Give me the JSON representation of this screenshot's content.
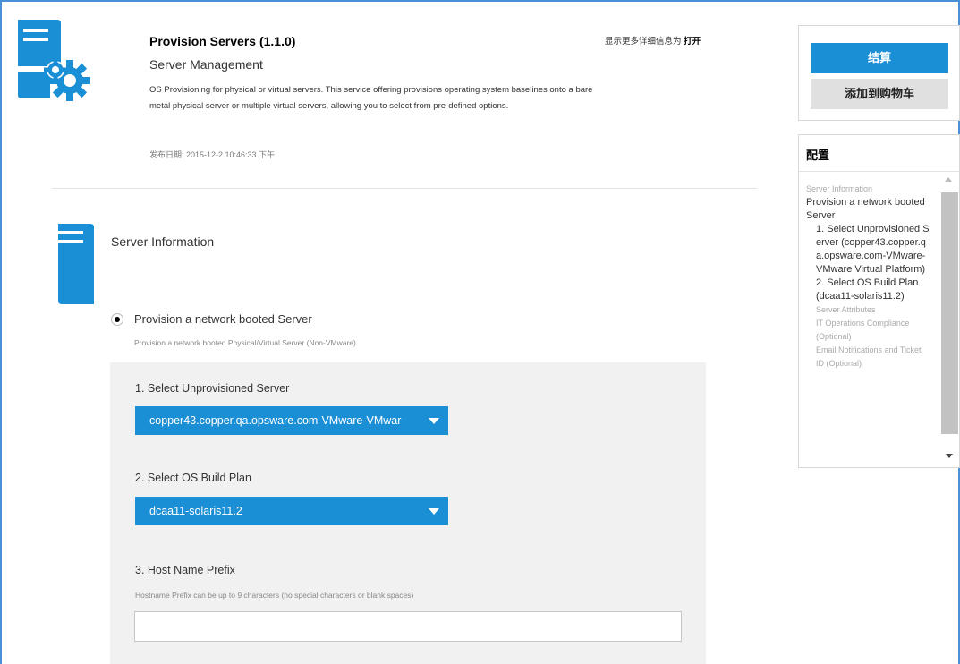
{
  "service": {
    "title": "Provision Servers (1.1.0)",
    "subtitle": "Server Management",
    "description": "OS Provisioning for physical or virtual servers. This service offering provisions operating system baselines onto a bare metal physical server or multiple virtual servers, allowing you to select from pre-defined options.",
    "date": "发布日期: 2015-12-2 10:46:33 下午",
    "show_more_prefix": "显示更多详细信息为",
    "show_more_link": "打开"
  },
  "section": {
    "title": "Server Information",
    "option_label": "Provision a network booted Server",
    "option_hint": "Provision a network booted Physical/Virtual Server (Non-VMware)"
  },
  "form": {
    "server_label": "1. Select Unprovisioned Server",
    "server_value": "copper43.copper.qa.opsware.com-VMware-VMwar",
    "build_label": "2. Select OS Build Plan",
    "build_value": "dcaa11-solaris11.2",
    "host_label": "3. Host Name Prefix",
    "host_hint": "Hostname Prefix can be up to 9 characters (no special characters or blank spaces)",
    "host_value": ""
  },
  "cart": {
    "checkout_label": "结算",
    "add_label": "添加到购物车"
  },
  "config": {
    "title": "配置",
    "items": [
      "Server Information",
      "Provision a network booted Server",
      "1. Select Unprovisioned Server (copper43.copper.qa.opsware.com-VMware-VMware Virtual Platform)",
      "2. Select OS Build Plan (dcaa11-solaris11.2)",
      "Server Attributes",
      "IT Operations Compliance (Optional)",
      "Email Notifications and Ticket ID (Optional)"
    ]
  },
  "colors": {
    "accent": "#1a8fd6",
    "frame": "#4a90d9",
    "panel": "#f1f1f1"
  }
}
